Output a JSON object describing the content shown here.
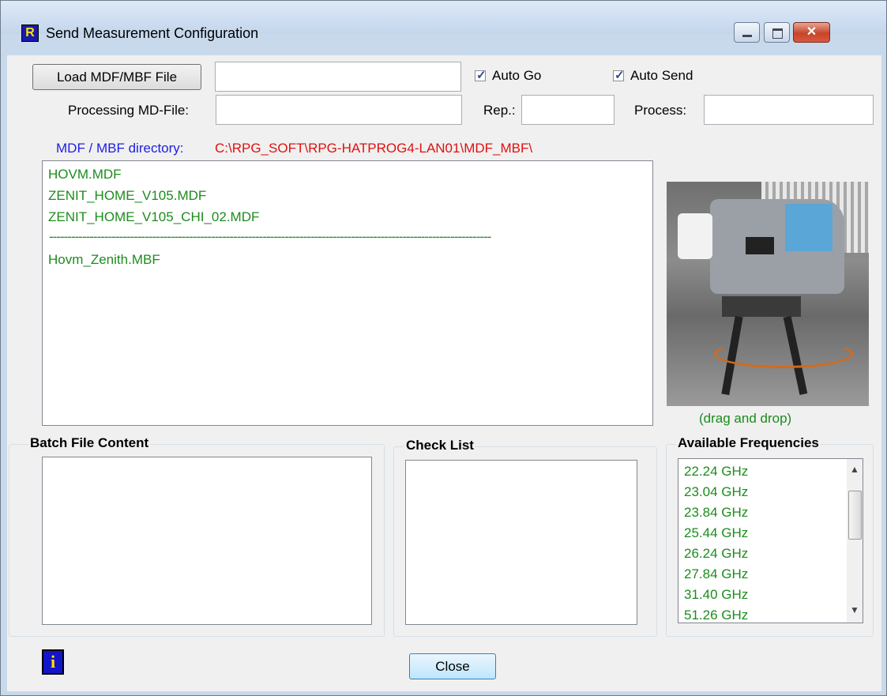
{
  "window": {
    "title": "Send Measurement Configuration",
    "icon": "app-icon"
  },
  "toolbar": {
    "load_button": "Load MDF/MBF File",
    "load_file_value": "",
    "auto_go_label": "Auto Go",
    "auto_go_checked": true,
    "auto_send_label": "Auto Send",
    "auto_send_checked": true
  },
  "processing": {
    "md_file_label": "Processing MD-File:",
    "md_file_value": "",
    "rep_label": "Rep.:",
    "rep_value": "",
    "process_label": "Process:",
    "process_value": ""
  },
  "directory": {
    "label": "MDF / MBF directory:",
    "path": "C:\\RPG_SOFT\\RPG-HATPROG4-LAN01\\MDF_MBF\\"
  },
  "file_list": {
    "mdf_files": [
      "HOVM.MDF",
      "ZENIT_HOME_V105.MDF",
      "ZENIT_HOME_V105_CHI_02.MDF"
    ],
    "separator": "------------------------------------------------------------------------------------------------------------------------",
    "mbf_files": [
      "Hovm_Zenith.MBF"
    ]
  },
  "image": {
    "caption": "(drag and drop)"
  },
  "batch": {
    "title": "Batch File Content",
    "items": []
  },
  "checklist": {
    "title": "Check List",
    "items": []
  },
  "frequencies": {
    "title": "Available Frequencies",
    "items": [
      "22.24 GHz",
      "23.04 GHz",
      "23.84 GHz",
      "25.44 GHz",
      "26.24 GHz",
      "27.84 GHz",
      "31.40 GHz",
      "51.26 GHz"
    ]
  },
  "footer": {
    "close_button": "Close",
    "info_icon": "info-icon"
  },
  "colors": {
    "list_text": "#1c8c1c",
    "directory_label": "#2020e0",
    "directory_path": "#e01010"
  }
}
